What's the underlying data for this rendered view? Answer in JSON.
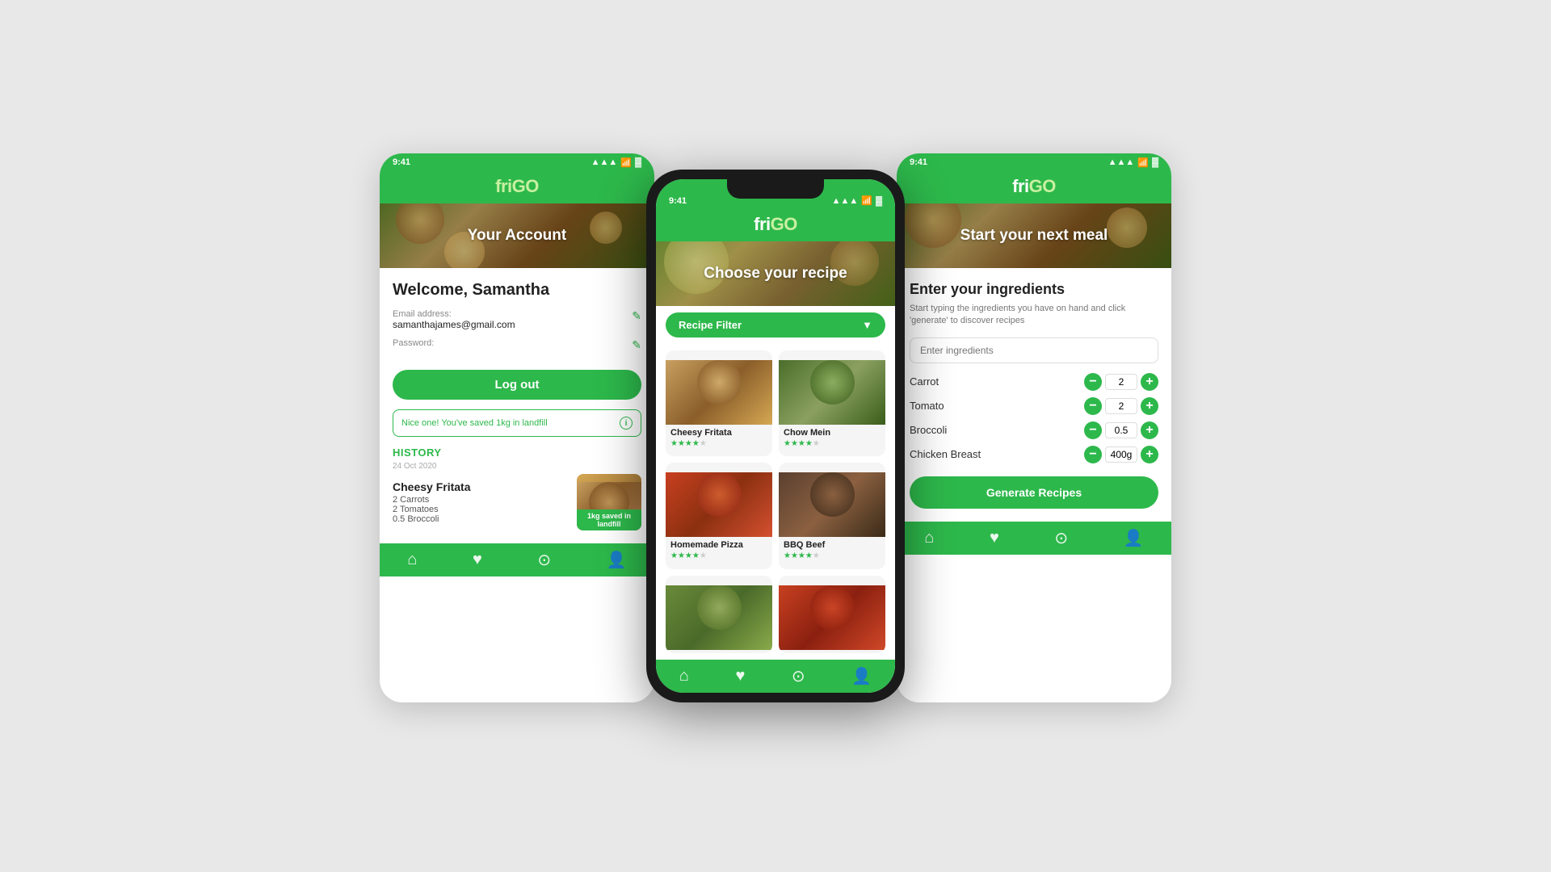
{
  "app": {
    "name": "friGO",
    "name_styled": "fri",
    "name_styled2": "GO"
  },
  "status_bar": {
    "time": "9:41",
    "time_center": "9:41",
    "signal": "▲▲▲",
    "wifi": "WiFi",
    "battery": "Battery"
  },
  "left_phone": {
    "hero_text": "Your Account",
    "welcome": "Welcome, Samantha",
    "email_label": "Email address:",
    "email_value": "samanthajames@gmail.com",
    "password_label": "Password:",
    "password_value": "••••••••",
    "logout_btn": "Log out",
    "landfill_notice": "Nice one! You've saved 1kg in landfill",
    "history_label": "HISTORY",
    "history_date": "24 Oct 2020",
    "history_title": "Cheesy Fritata",
    "history_detail1": "2 Carrots",
    "history_detail2": "2 Tomatoes",
    "history_detail3": "0.5 Broccoli",
    "saved_badge": "1kg saved in landfill"
  },
  "center_phone": {
    "hero_text": "Choose your recipe",
    "filter_label": "Recipe Filter",
    "recipes": [
      {
        "name": "Cheesy Fritata",
        "stars": 3.5
      },
      {
        "name": "Chow Mein",
        "stars": 3.5
      },
      {
        "name": "Homemade Pizza",
        "stars": 3.5
      },
      {
        "name": "BBQ Beef",
        "stars": 3.5
      }
    ]
  },
  "right_phone": {
    "hero_text": "Start your next meal",
    "title": "Enter your ingredients",
    "subtitle": "Start typing the ingredients you have on hand and click 'generate' to discover recipes",
    "input_placeholder": "Enter ingredients",
    "ingredients": [
      {
        "name": "Carrot",
        "qty": "2"
      },
      {
        "name": "Tomato",
        "qty": "2"
      },
      {
        "name": "Broccoli",
        "qty": "0.5"
      },
      {
        "name": "Chicken Breast",
        "qty": "400g"
      }
    ],
    "generate_btn": "Generate Recipes"
  },
  "nav": {
    "home": "🏠",
    "heart": "♥",
    "search": "🔍",
    "user": "👤"
  }
}
